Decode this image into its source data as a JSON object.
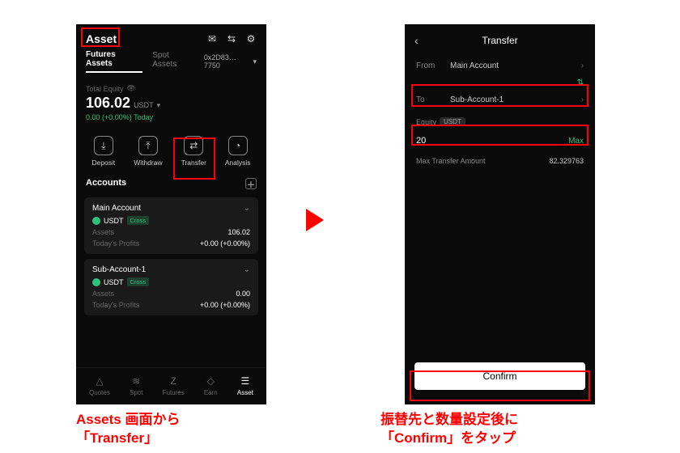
{
  "left": {
    "title": "Asset",
    "tabs": {
      "futures": "Futures Assets",
      "spot": "Spot Assets"
    },
    "address": "0x2D83…7750",
    "equity": {
      "label": "Total Equity",
      "value": "106.02",
      "unit": "USDT",
      "change": "0.00 (+0.00%) Today"
    },
    "actions": {
      "deposit": "Deposit",
      "withdraw": "Withdraw",
      "transfer": "Transfer",
      "analysis": "Analysis"
    },
    "accounts_label": "Accounts",
    "accounts": [
      {
        "name": "Main Account",
        "coin": "USDT",
        "mode": "Cross",
        "assets_label": "Assets",
        "assets_value": "106.02",
        "profits_label": "Today's Profits",
        "profits_value": "+0.00  (+0.00%)"
      },
      {
        "name": "Sub-Account-1",
        "coin": "USDT",
        "mode": "Cross",
        "assets_label": "Assets",
        "assets_value": "0.00",
        "profits_label": "Today's Profits",
        "profits_value": "+0.00  (+0.00%)"
      }
    ],
    "nav": {
      "quotes": "Quotes",
      "spot": "Spot",
      "futures": "Futures",
      "earn": "Earn",
      "asset": "Asset"
    }
  },
  "right": {
    "title": "Transfer",
    "from_label": "From",
    "from_value": "Main Account",
    "to_label": "To",
    "to_value": "Sub-Account-1",
    "equity_label": "Equity",
    "equity_unit": "USDT",
    "amount": "20",
    "max_label": "Max",
    "max_transfer_label": "Max Transfer Amount",
    "max_transfer_value": "82.329763",
    "confirm": "Confirm"
  },
  "captions": {
    "left": "Assets 画面から\n「Transfer」",
    "right": "振替先と数量設定後に\n「Confirm」をタップ"
  }
}
